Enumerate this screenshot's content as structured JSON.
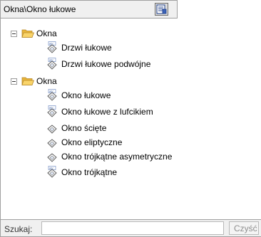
{
  "header": {
    "title": "Okna\\Okno łukowe",
    "button_icon": "save-list-icon"
  },
  "tree": {
    "groups": [
      {
        "label": "Okna",
        "expanded": true,
        "items": [
          {
            "label": "Drzwi łukowe"
          },
          {
            "label": "Drzwi łukowe podwójne"
          }
        ]
      },
      {
        "label": "Okna",
        "expanded": true,
        "items": [
          {
            "label": "Okno łukowe"
          },
          {
            "label": "Okno łukowe z lufcikiem"
          },
          {
            "label": "Okno ścięte"
          },
          {
            "label": "Okno eliptyczne"
          },
          {
            "label": "Okno trójkątne asymetryczne"
          },
          {
            "label": "Okno trójkątne"
          }
        ]
      }
    ]
  },
  "search": {
    "label": "Szukaj:",
    "value": "",
    "clear_label": "Czyść"
  },
  "colors": {
    "folder": "#f6c44a",
    "border": "#a0a0a0",
    "panel_bg": "#f0f0f0"
  }
}
